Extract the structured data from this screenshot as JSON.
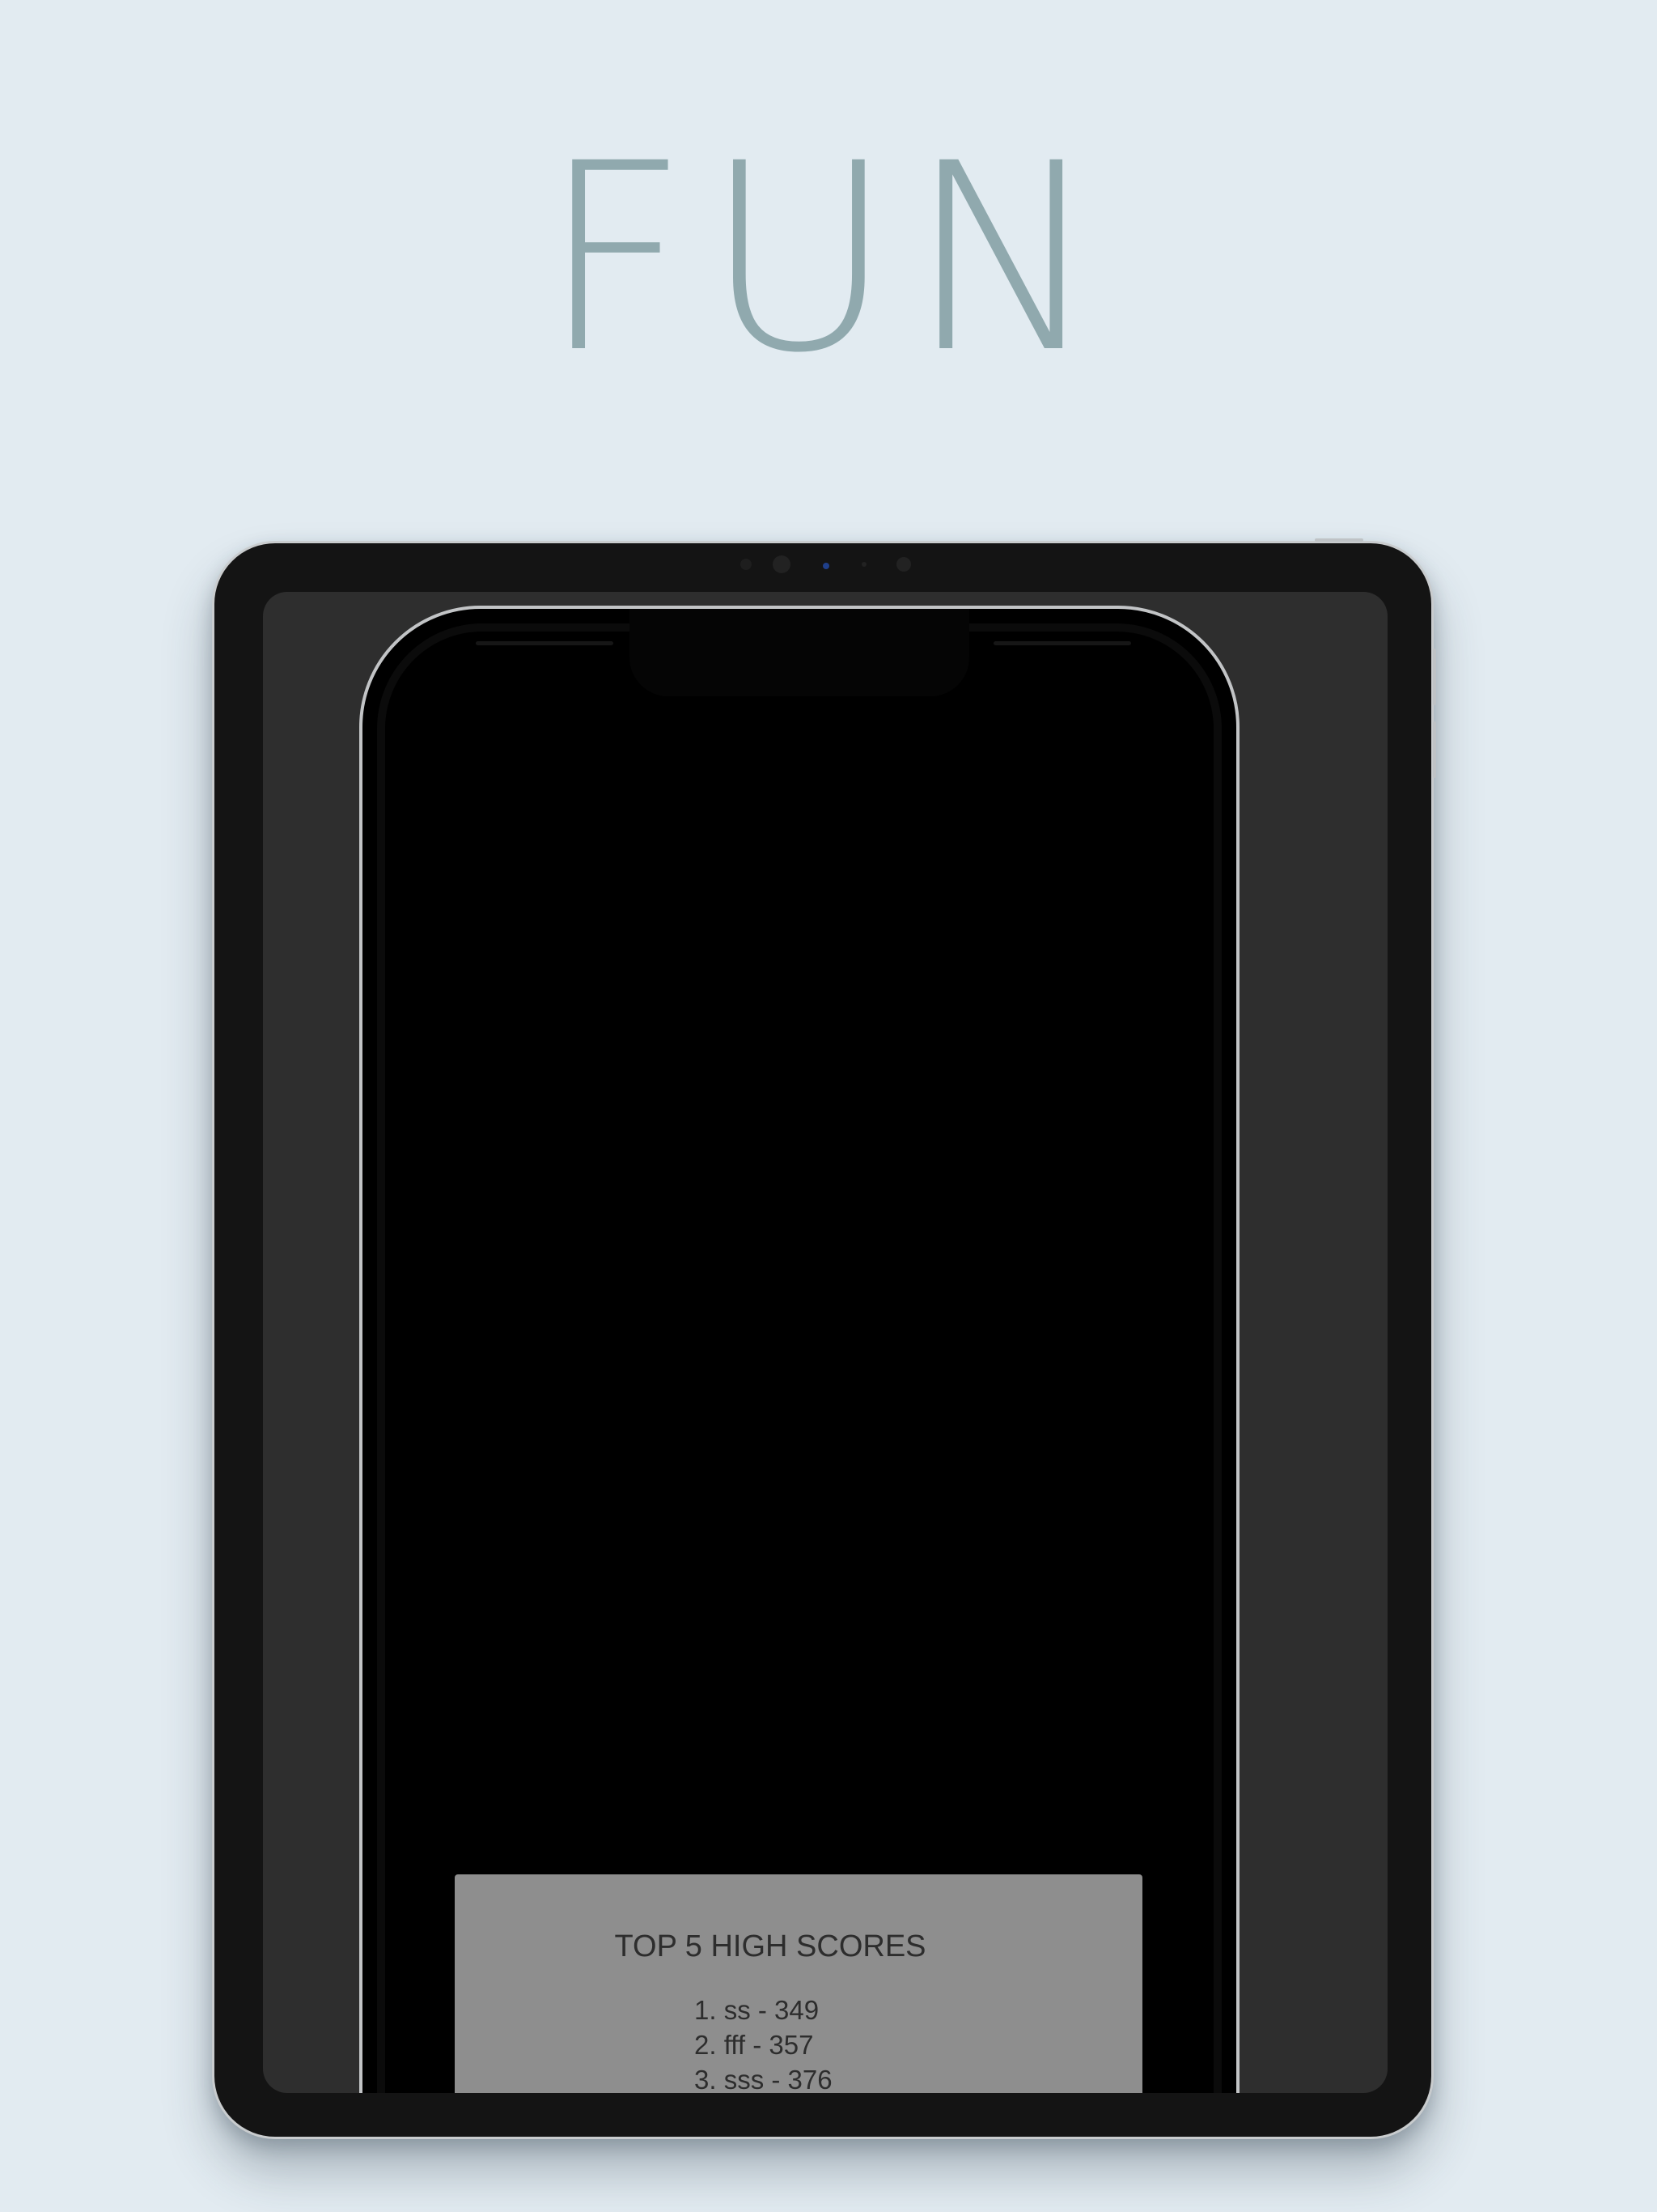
{
  "headline": "FUN",
  "game": {
    "high_scores": {
      "title": "TOP 5 HIGH SCORES",
      "entries": [
        {
          "rank": "1.",
          "name": "ss",
          "score": "349"
        },
        {
          "rank": "2.",
          "name": "fff",
          "score": "357"
        },
        {
          "rank": "3.",
          "name": "sss",
          "score": "376"
        }
      ]
    }
  },
  "colors": {
    "background": "#e2ebf1",
    "headline": "#90a9ae",
    "device_frame": "#141414",
    "panel": "#8e8e8e"
  }
}
